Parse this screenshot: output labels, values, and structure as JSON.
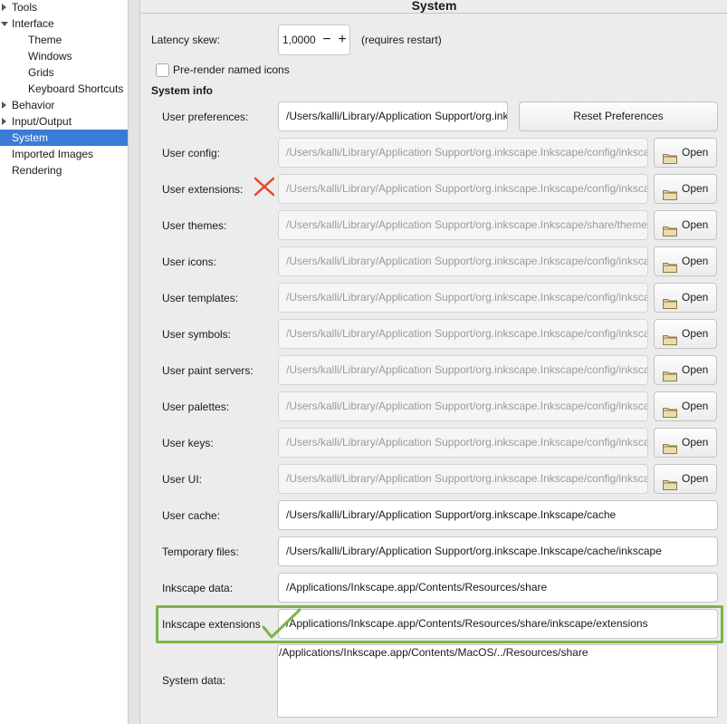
{
  "sidebar": {
    "items": [
      {
        "label": "Tools",
        "arrow": "right",
        "indent": 1
      },
      {
        "label": "Interface",
        "arrow": "down",
        "indent": 1
      },
      {
        "label": "Theme",
        "arrow": "",
        "indent": 2
      },
      {
        "label": "Windows",
        "arrow": "",
        "indent": 2
      },
      {
        "label": "Grids",
        "arrow": "",
        "indent": 2
      },
      {
        "label": "Keyboard Shortcuts",
        "arrow": "",
        "indent": 2
      },
      {
        "label": "Behavior",
        "arrow": "right",
        "indent": 1
      },
      {
        "label": "Input/Output",
        "arrow": "right",
        "indent": 1
      },
      {
        "label": "System",
        "arrow": "",
        "indent": 1,
        "selected": true
      },
      {
        "label": "Imported Images",
        "arrow": "",
        "indent": 1
      },
      {
        "label": "Rendering",
        "arrow": "",
        "indent": 1
      }
    ]
  },
  "page": {
    "title": "System",
    "latency_label": "Latency skew:",
    "latency_value": "1,0000",
    "latency_minus": "−",
    "latency_plus": "+",
    "latency_note": "(requires restart)",
    "prerender_label": "Pre-render named icons",
    "prerender_checked": false,
    "system_info_heading": "System info",
    "reset_button": "Reset Preferences",
    "open_button": "Open",
    "rows": [
      {
        "label": "User preferences:",
        "value": "/Users/kalli/Library/Application Support/org.inkscape.Inkscape/config/inkscape/preferences.xml",
        "disabled": false,
        "button": "reset"
      },
      {
        "label": "User config:",
        "value": "/Users/kalli/Library/Application Support/org.inkscape.Inkscape/config/inkscape",
        "disabled": true,
        "button": "open"
      },
      {
        "label": "User extensions:",
        "value": "/Users/kalli/Library/Application Support/org.inkscape.Inkscape/config/inkscape/extensions",
        "disabled": true,
        "button": "open"
      },
      {
        "label": "User themes:",
        "value": "/Users/kalli/Library/Application Support/org.inkscape.Inkscape/share/themes",
        "disabled": true,
        "button": "open"
      },
      {
        "label": "User icons:",
        "value": "/Users/kalli/Library/Application Support/org.inkscape.Inkscape/config/inkscape/icons",
        "disabled": true,
        "button": "open"
      },
      {
        "label": "User templates:",
        "value": "/Users/kalli/Library/Application Support/org.inkscape.Inkscape/config/inkscape/templates",
        "disabled": true,
        "button": "open"
      },
      {
        "label": "User symbols:",
        "value": "/Users/kalli/Library/Application Support/org.inkscape.Inkscape/config/inkscape/symbols",
        "disabled": true,
        "button": "open"
      },
      {
        "label": "User paint servers:",
        "value": "/Users/kalli/Library/Application Support/org.inkscape.Inkscape/config/inkscape/paint",
        "disabled": true,
        "button": "open"
      },
      {
        "label": "User palettes:",
        "value": "/Users/kalli/Library/Application Support/org.inkscape.Inkscape/config/inkscape/palettes",
        "disabled": true,
        "button": "open"
      },
      {
        "label": "User keys:",
        "value": "/Users/kalli/Library/Application Support/org.inkscape.Inkscape/config/inkscape/keys",
        "disabled": true,
        "button": "open"
      },
      {
        "label": "User UI:",
        "value": "/Users/kalli/Library/Application Support/org.inkscape.Inkscape/config/inkscape/ui",
        "disabled": true,
        "button": "open"
      },
      {
        "label": "User cache:",
        "value": "/Users/kalli/Library/Application Support/org.inkscape.Inkscape/cache",
        "disabled": false,
        "button": "",
        "wide": true
      },
      {
        "label": "Temporary files:",
        "value": "/Users/kalli/Library/Application Support/org.inkscape.Inkscape/cache/inkscape",
        "disabled": false,
        "button": "",
        "wide": true
      },
      {
        "label": "Inkscape data:",
        "value": "/Applications/Inkscape.app/Contents/Resources/share",
        "disabled": false,
        "button": "",
        "wide": true
      },
      {
        "label": "Inkscape extensions",
        "value": "/Applications/Inkscape.app/Contents/Resources/share/inkscape/extensions",
        "disabled": false,
        "button": "",
        "wide": true
      }
    ],
    "system_data_label": "System data:",
    "system_data_value": "/Applications/Inkscape.app/Contents/MacOS/../Resources/share"
  },
  "annotations": {
    "cross_color": "#e8432a",
    "check_color": "#7ab648"
  }
}
